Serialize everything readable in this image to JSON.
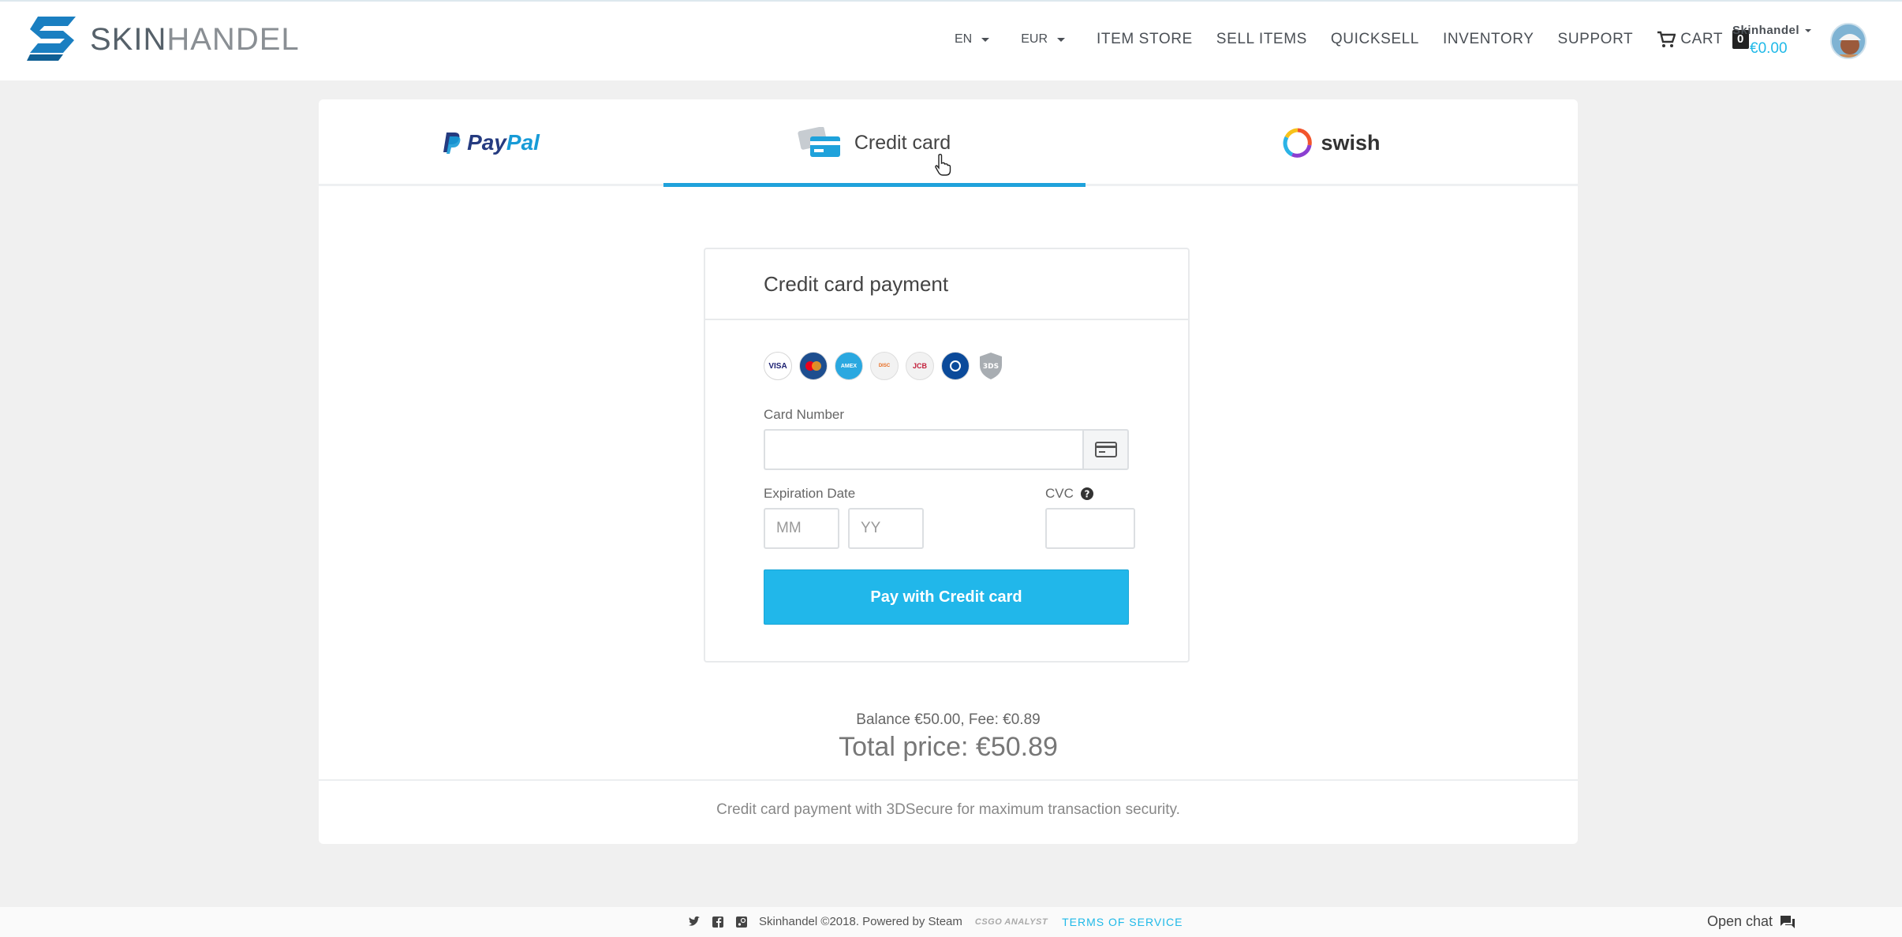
{
  "header": {
    "logo_text_strong": "SKIN",
    "logo_text_light": "HANDEL",
    "lang": "EN",
    "currency": "EUR",
    "nav": [
      "ITEM STORE",
      "SELL ITEMS",
      "QUICKSELL",
      "INVENTORY",
      "SUPPORT"
    ],
    "cart_label": "CART",
    "cart_count": "0",
    "username": "Skinhandel",
    "balance": "€0.00"
  },
  "tabs": {
    "paypal_1": "Pay",
    "paypal_2": "Pal",
    "credit_card": "Credit card",
    "swish": "swish",
    "active": "credit_card",
    "accent": "#1fa2db"
  },
  "form": {
    "title": "Credit card payment",
    "brands": [
      "visa-icon",
      "mastercard-icon",
      "amex-icon",
      "discover-icon",
      "jcb-icon",
      "diners-icon",
      "3ds-icon"
    ],
    "card_number_label": "Card Number",
    "card_number_value": "",
    "expiration_label": "Expiration Date",
    "mm_placeholder": "MM",
    "yy_placeholder": "YY",
    "cvc_label": "CVC",
    "cvc_value": "",
    "pay_button": "Pay with Credit card",
    "button_color": "#21b7ea"
  },
  "summary": {
    "balance_fee": "Balance €50.00, Fee: €0.89",
    "total": "Total price: €50.89",
    "note": "Credit card payment with 3DSecure for maximum transaction security."
  },
  "footer": {
    "copyright": "Skinhandel ©2018. Powered by Steam",
    "partner": "CSGO ANALYST",
    "terms": "TERMS OF SERVICE",
    "open_chat": "Open chat"
  }
}
